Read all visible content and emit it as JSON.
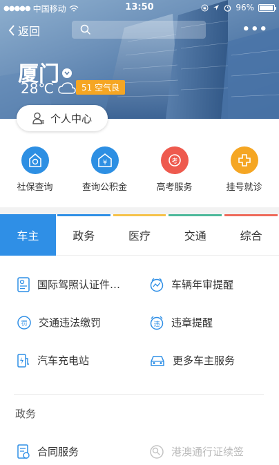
{
  "status": {
    "carrier": "中国移动",
    "time": "13:50",
    "battery": "96%"
  },
  "nav": {
    "back_label": "返回",
    "more_label": "•••"
  },
  "weather": {
    "city": "厦门",
    "temperature": "28℃",
    "aqi": "51 空气良"
  },
  "personal_center": "个人中心",
  "quick": [
    {
      "label": "社保查询",
      "color": "#2d8fe3"
    },
    {
      "label": "查询公积金",
      "color": "#2d8fe3"
    },
    {
      "label": "高考服务",
      "color": "#ee5a4e"
    },
    {
      "label": "挂号就诊",
      "color": "#f5a623"
    }
  ],
  "tabs": [
    {
      "label": "车主",
      "color": "#2f8fe6",
      "active": true
    },
    {
      "label": "政务",
      "color": "#2f8fe6"
    },
    {
      "label": "医疗",
      "color": "#f5c24a"
    },
    {
      "label": "交通",
      "color": "#4cb89a"
    },
    {
      "label": "综合",
      "color": "#ee6a5a"
    }
  ],
  "services": [
    {
      "label": "国际驾照认证件…",
      "icon": "license-icon"
    },
    {
      "label": "车辆年审提醒",
      "icon": "inspection-icon"
    },
    {
      "label": "交通违法缴罚",
      "icon": "fine-icon"
    },
    {
      "label": "违章提醒",
      "icon": "violation-icon"
    },
    {
      "label": "汽车充电站",
      "icon": "charging-icon"
    },
    {
      "label": "更多车主服务",
      "icon": "car-icon"
    }
  ],
  "section": {
    "title": "政务",
    "items": [
      {
        "label": "合同服务",
        "icon": "contract-icon",
        "enabled": true
      },
      {
        "label": "港澳通行证续签",
        "icon": "passport-icon",
        "enabled": false
      }
    ]
  }
}
